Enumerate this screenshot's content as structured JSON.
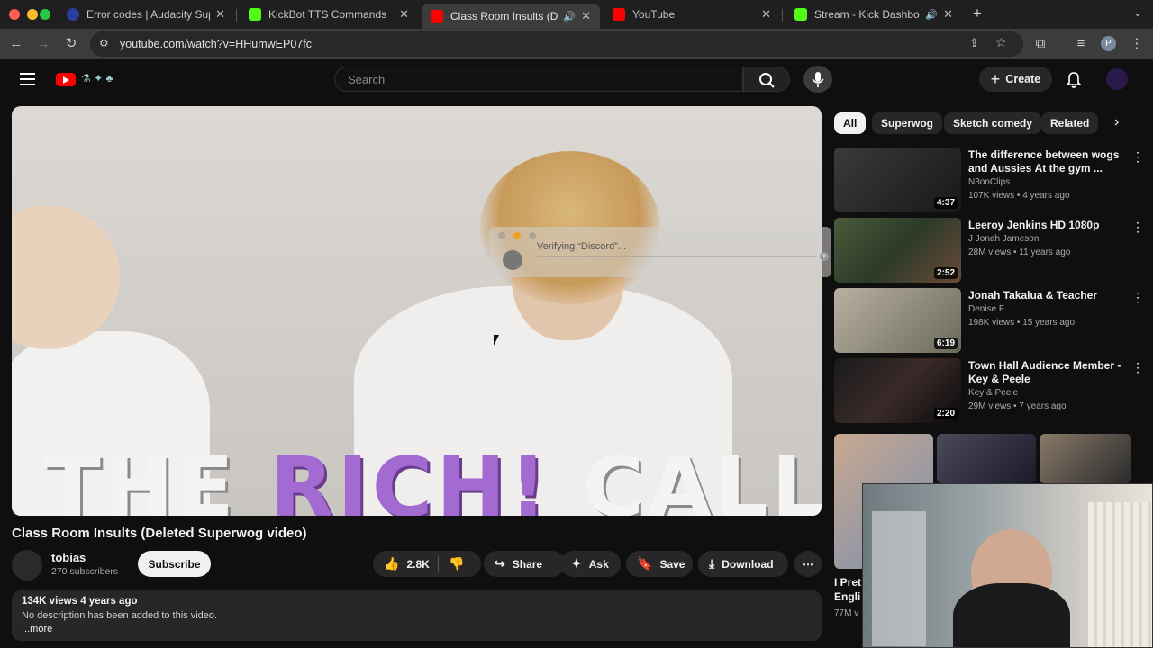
{
  "browser": {
    "tabs": [
      {
        "title": "Error codes | Audacity Suppor",
        "active": false,
        "favicon_color": "#2a3f9d"
      },
      {
        "title": "KickBot TTS Commands",
        "active": false,
        "favicon_color": "#53fc18"
      },
      {
        "title": "Class Room Insults (Delet",
        "active": true,
        "favicon_color": "#ff0000"
      },
      {
        "title": "YouTube",
        "active": false,
        "favicon_color": "#ff0000"
      },
      {
        "title": "Stream - Kick Dashboard",
        "active": false,
        "favicon_color": "#53fc18"
      }
    ],
    "url": "youtube.com/watch?v=HHumwEP07fc",
    "profile_initial": "P"
  },
  "header": {
    "search_placeholder": "Search",
    "create_label": "Create"
  },
  "video": {
    "overlay_text_1": "THE",
    "overlay_text_2": "RICH!",
    "overlay_text_3": "CALL",
    "verifying_text": "Verifying “Discord”..."
  },
  "meta": {
    "title": "Class Room Insults (Deleted Superwog video)",
    "channel": "tobias",
    "subscribers": "270 subscribers",
    "subscribe_label": "Subscribe",
    "likes": "2.8K",
    "share_label": "Share",
    "ask_label": "Ask",
    "save_label": "Save",
    "download_label": "Download",
    "views_date": "134K views  4 years ago",
    "description": "No description has been added to this video.",
    "more_label": "...more"
  },
  "chips": [
    "All",
    "Superwog",
    "Sketch comedy",
    "Related"
  ],
  "related": [
    {
      "title": "The difference between wogs and Aussies At the gym ...",
      "channel": "N3onClips",
      "meta": "107K views • 4 years ago",
      "duration": "4:37"
    },
    {
      "title": "Leeroy Jenkins HD 1080p",
      "channel": "J Jonah Jameson",
      "meta": "28M views • 11 years ago",
      "duration": "2:52"
    },
    {
      "title": "Jonah Takalua & Teacher",
      "channel": "Denise F",
      "meta": "198K views • 15 years ago",
      "duration": "6:19"
    },
    {
      "title": "Town Hall Audience Member - Key & Peele",
      "channel": "Key & Peele",
      "meta": "29M views • 7 years ago",
      "duration": "2:20"
    }
  ],
  "shorts_partial": {
    "title_fragment": "I Pret",
    "title_fragment_2": "Engli",
    "views_fragment": "77M v"
  },
  "colors": {
    "bg": "#0f0f0f",
    "accent_red": "#ff0000",
    "purple_text": "#a36bd1"
  }
}
